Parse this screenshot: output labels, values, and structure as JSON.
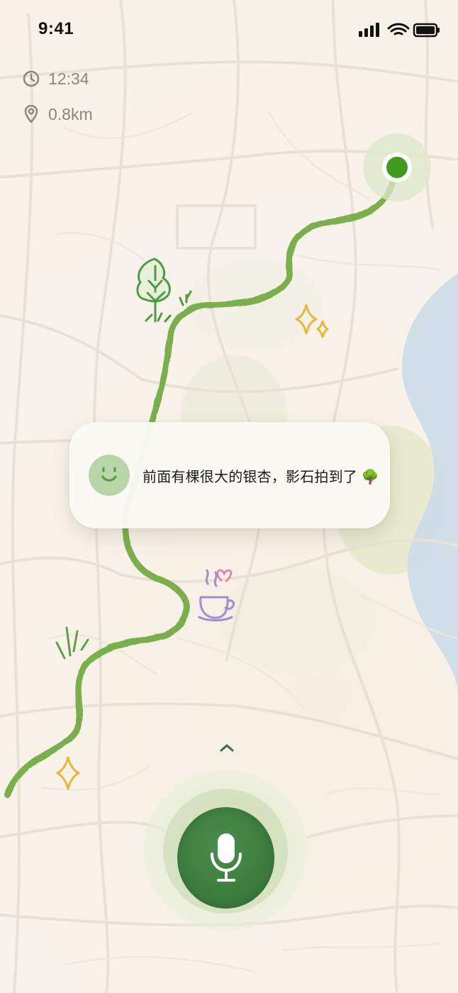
{
  "status_bar": {
    "time": "9:41",
    "icons": [
      "cellular-signal-icon",
      "wifi-icon",
      "battery-icon"
    ]
  },
  "stats": {
    "duration": "12:34",
    "distance": "0.8km"
  },
  "companion": {
    "message": "前面有棵很大的银杏，影石拍到了 🌳",
    "avatar_icon": "smiley-avatar-icon"
  },
  "controls": {
    "expand_icon": "chevron-up-icon",
    "mic_icon": "microphone-icon"
  },
  "map": {
    "route_color": "#74ac45",
    "start_color": "#3f9a22",
    "river_color": "#cbdce8",
    "decorations": [
      "tree-doodle-icon",
      "sparkle-icon",
      "coffee-cup-icon",
      "heart-icon",
      "grass-doodle-icon"
    ]
  },
  "colors": {
    "background": "#f8f3ea",
    "accent": "#3d7e3f",
    "muted_text": "#8a8680"
  }
}
